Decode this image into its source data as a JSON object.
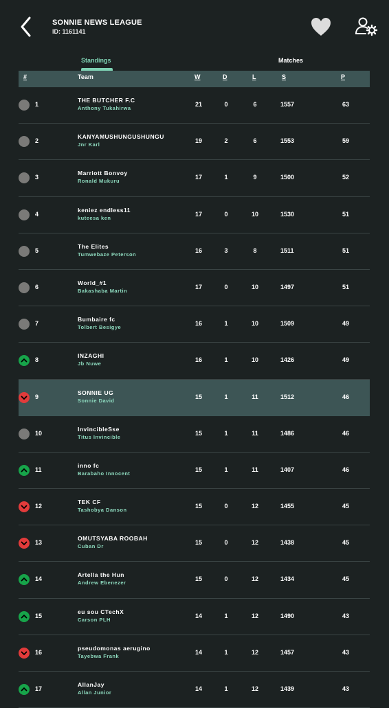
{
  "header": {
    "league_title": "SONNIE NEWS LEAGUE",
    "league_id": "ID: 1161141"
  },
  "tabs": [
    {
      "label": "Standings",
      "active": true
    },
    {
      "label": "Matches",
      "active": false
    }
  ],
  "table": {
    "columns": [
      "#",
      "Team",
      "W",
      "D",
      "L",
      "S",
      "P"
    ],
    "rows": [
      {
        "pos": "1",
        "team": "THE BUTCHER F.C",
        "manager": "Anthony Tukahirwa",
        "w": "21",
        "d": "0",
        "l": "6",
        "s": "1557",
        "p": "63",
        "trend": "neutral"
      },
      {
        "pos": "2",
        "team": "KANYAMUSHUNGUSHUNGU",
        "manager": "Jnr Karl",
        "w": "19",
        "d": "2",
        "l": "6",
        "s": "1553",
        "p": "59",
        "trend": "neutral"
      },
      {
        "pos": "3",
        "team": "Marriott Bonvoy",
        "manager": "Ronald Mukuru",
        "w": "17",
        "d": "1",
        "l": "9",
        "s": "1500",
        "p": "52",
        "trend": "neutral"
      },
      {
        "pos": "4",
        "team": "keniez endless11",
        "manager": "kuteesa ken",
        "w": "17",
        "d": "0",
        "l": "10",
        "s": "1530",
        "p": "51",
        "trend": "neutral"
      },
      {
        "pos": "5",
        "team": "The Elites",
        "manager": "Tumwebaze Peterson",
        "w": "16",
        "d": "3",
        "l": "8",
        "s": "1511",
        "p": "51",
        "trend": "neutral"
      },
      {
        "pos": "6",
        "team": "World_#1",
        "manager": "Bakashaba Martin",
        "w": "17",
        "d": "0",
        "l": "10",
        "s": "1497",
        "p": "51",
        "trend": "neutral"
      },
      {
        "pos": "7",
        "team": "Bumbaire fc",
        "manager": "Tolbert Besigye",
        "w": "16",
        "d": "1",
        "l": "10",
        "s": "1509",
        "p": "49",
        "trend": "neutral"
      },
      {
        "pos": "8",
        "team": "INZAGHI",
        "manager": "Jb Nuwe",
        "w": "16",
        "d": "1",
        "l": "10",
        "s": "1426",
        "p": "49",
        "trend": "up"
      },
      {
        "pos": "9",
        "team": "SONNIE UG",
        "manager": "Sonnie David",
        "w": "15",
        "d": "1",
        "l": "11",
        "s": "1512",
        "p": "46",
        "trend": "down",
        "highlight": true
      },
      {
        "pos": "10",
        "team": "InvincibleSse",
        "manager": "Titus Invincible",
        "w": "15",
        "d": "1",
        "l": "11",
        "s": "1486",
        "p": "46",
        "trend": "neutral"
      },
      {
        "pos": "11",
        "team": "inno fc",
        "manager": "Barabaho Innocent",
        "w": "15",
        "d": "1",
        "l": "11",
        "s": "1407",
        "p": "46",
        "trend": "up"
      },
      {
        "pos": "12",
        "team": "TEK CF",
        "manager": "Tashobya Danson",
        "w": "15",
        "d": "0",
        "l": "12",
        "s": "1455",
        "p": "45",
        "trend": "down"
      },
      {
        "pos": "13",
        "team": "OMUTSYABA ROOBAH",
        "manager": "Cuban Dr",
        "w": "15",
        "d": "0",
        "l": "12",
        "s": "1438",
        "p": "45",
        "trend": "down"
      },
      {
        "pos": "14",
        "team": "Artella the Hun",
        "manager": "Andrew Ebenezer",
        "w": "15",
        "d": "0",
        "l": "12",
        "s": "1434",
        "p": "45",
        "trend": "up"
      },
      {
        "pos": "15",
        "team": "eu sou CTechX",
        "manager": "Carson PLH",
        "w": "14",
        "d": "1",
        "l": "12",
        "s": "1490",
        "p": "43",
        "trend": "up"
      },
      {
        "pos": "16",
        "team": "pseudomonas aerugino",
        "manager": "Tayebwa Frank",
        "w": "14",
        "d": "1",
        "l": "12",
        "s": "1457",
        "p": "43",
        "trend": "down"
      },
      {
        "pos": "17",
        "team": "AllanJay",
        "manager": "Allan Junior",
        "w": "14",
        "d": "1",
        "l": "12",
        "s": "1439",
        "p": "43",
        "trend": "up"
      }
    ]
  },
  "colors": {
    "background": "#1c2222",
    "accent": "#7fd3b4",
    "header_row": "#3d5555",
    "up": "#17a44a",
    "down": "#e23b3b",
    "neutral": "#7a7a78"
  },
  "icons": {
    "back": "chevron-left-icon",
    "favorite": "heart-icon",
    "user_settings": "user-gear-icon",
    "up": "chevron-up-icon",
    "down": "chevron-down-icon"
  }
}
